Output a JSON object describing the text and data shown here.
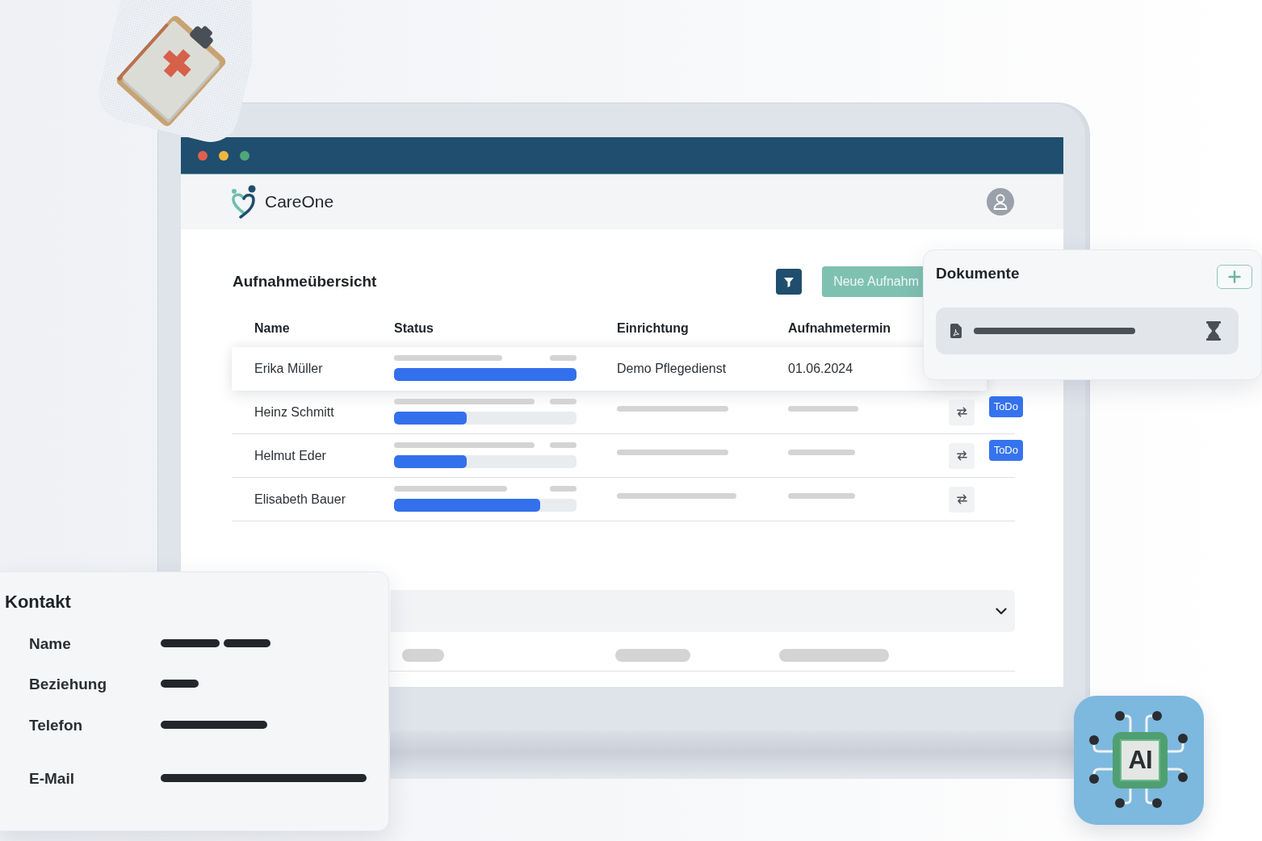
{
  "window": {
    "buttons": [
      {
        "color": "#e35f4e"
      },
      {
        "color": "#efb73e"
      },
      {
        "color": "#4fa679"
      }
    ]
  },
  "header": {
    "app_name": "CareOne"
  },
  "overview": {
    "title": "Aufnahmeübersicht",
    "new_button": "Neue Aufnahm"
  },
  "table": {
    "columns": [
      "Name",
      "Status",
      "Einrichtung",
      "Aufnahmetermin"
    ],
    "rows": [
      {
        "name": "Erika Müller",
        "selected": true,
        "level": 1,
        "facility": "Demo Pflegedienst",
        "date": "01.06.2024",
        "has_action": false
      },
      {
        "name": "Heinz Schmitt",
        "selected": false,
        "level": 0.4,
        "badge": "ToDo",
        "has_action": true
      },
      {
        "name": "Helmut Eder",
        "selected": false,
        "level": 0.4,
        "badge": "ToDo",
        "has_action": true
      },
      {
        "name": "Elisabeth Bauer",
        "selected": false,
        "level": 0.8,
        "has_action": true
      }
    ]
  },
  "section": {
    "expanded": false
  },
  "documents": {
    "title": "Dokumente",
    "items": [
      {
        "kind": "pdf",
        "pending": true
      }
    ]
  },
  "contact": {
    "title": "Kontakt",
    "fields": [
      {
        "label": "Name"
      },
      {
        "label": "Beziehung"
      },
      {
        "label": "Telefon"
      },
      {
        "label": "E-Mail"
      }
    ]
  },
  "ai_tile": {
    "label": "AI"
  }
}
